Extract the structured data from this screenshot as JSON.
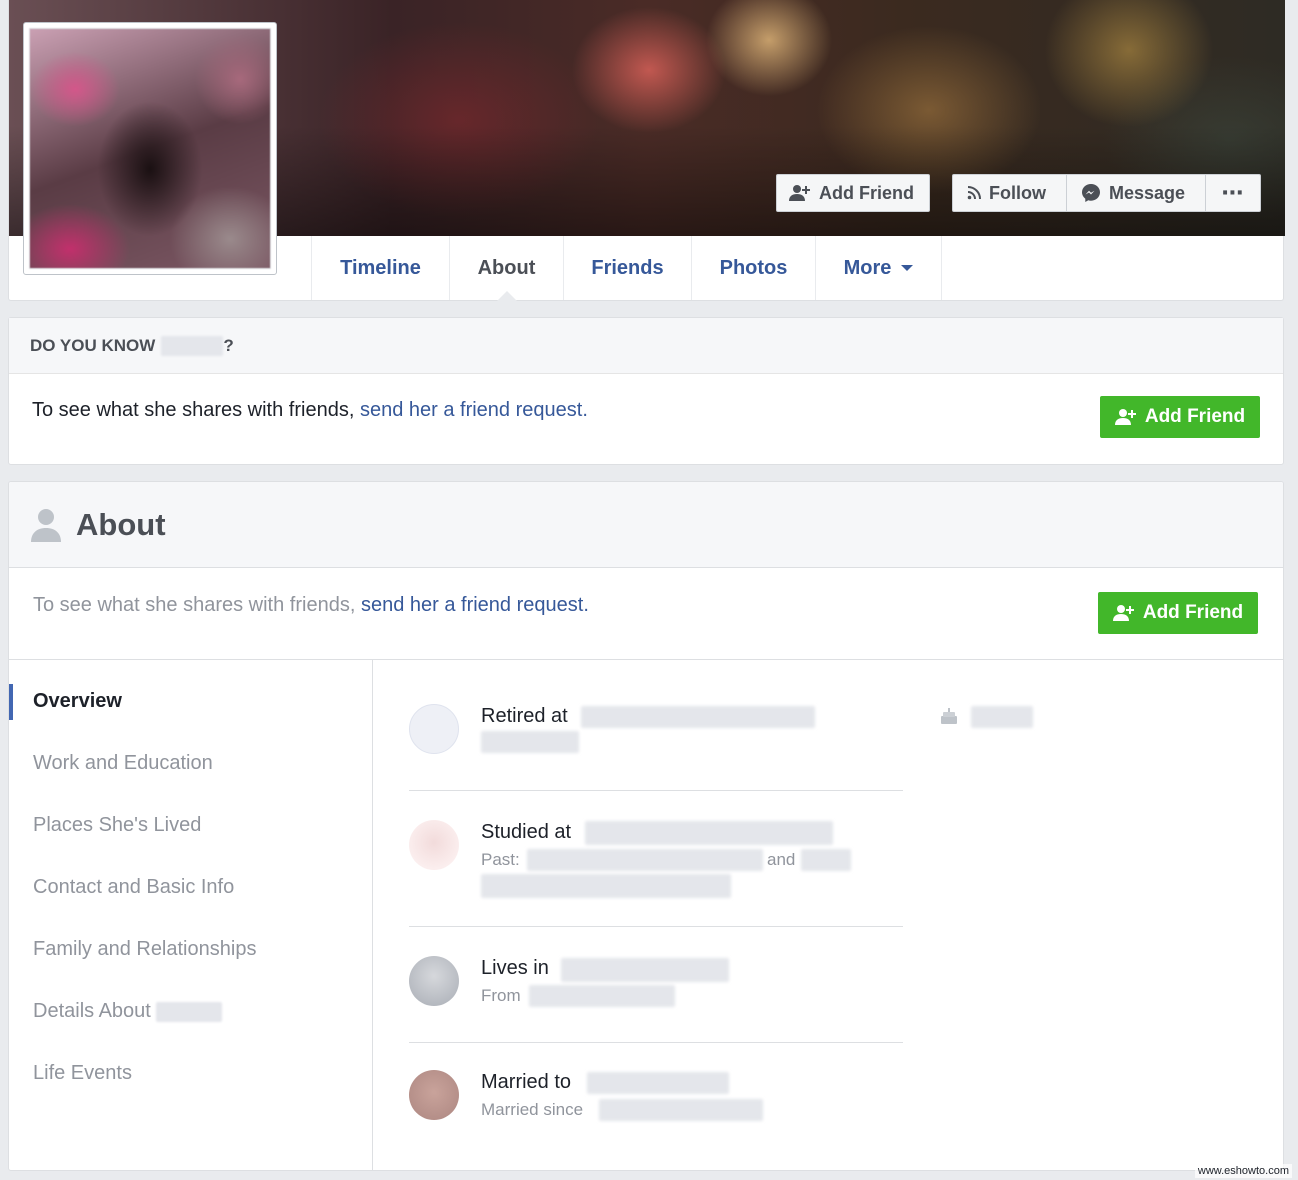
{
  "header": {
    "add_friend_label": "Add Friend",
    "follow_label": "Follow",
    "message_label": "Message",
    "more_dots": "⋯"
  },
  "tabs": [
    {
      "label": "Timeline"
    },
    {
      "label": "About"
    },
    {
      "label": "Friends"
    },
    {
      "label": "Photos"
    },
    {
      "label": "More"
    }
  ],
  "do_you_know": {
    "heading_prefix": "DO YOU KNOW",
    "heading_suffix": "?",
    "text": "To see what she shares with friends, ",
    "link": "send her a friend request.",
    "button": "Add Friend"
  },
  "about": {
    "title": "About",
    "text": "To see what she shares with friends, ",
    "link": "send her a friend request.",
    "button": "Add Friend"
  },
  "side_nav": [
    {
      "label": "Overview"
    },
    {
      "label": "Work and Education"
    },
    {
      "label": "Places She's Lived"
    },
    {
      "label": "Contact and Basic Info"
    },
    {
      "label": "Family and Relationships"
    },
    {
      "label": "Details About"
    },
    {
      "label": "Life Events"
    }
  ],
  "overview": {
    "retired": {
      "main": "Retired at"
    },
    "studied": {
      "main": "Studied at",
      "past": "Past:",
      "and": "and"
    },
    "lives": {
      "main": "Lives in",
      "from": "From"
    },
    "married": {
      "main": "Married to",
      "since": "Married since"
    }
  },
  "watermark": "www.eshowto.com",
  "colors": {
    "link": "#365899",
    "green": "#42b72a",
    "muted": "#90949c",
    "nav_active": "#4267b2"
  }
}
